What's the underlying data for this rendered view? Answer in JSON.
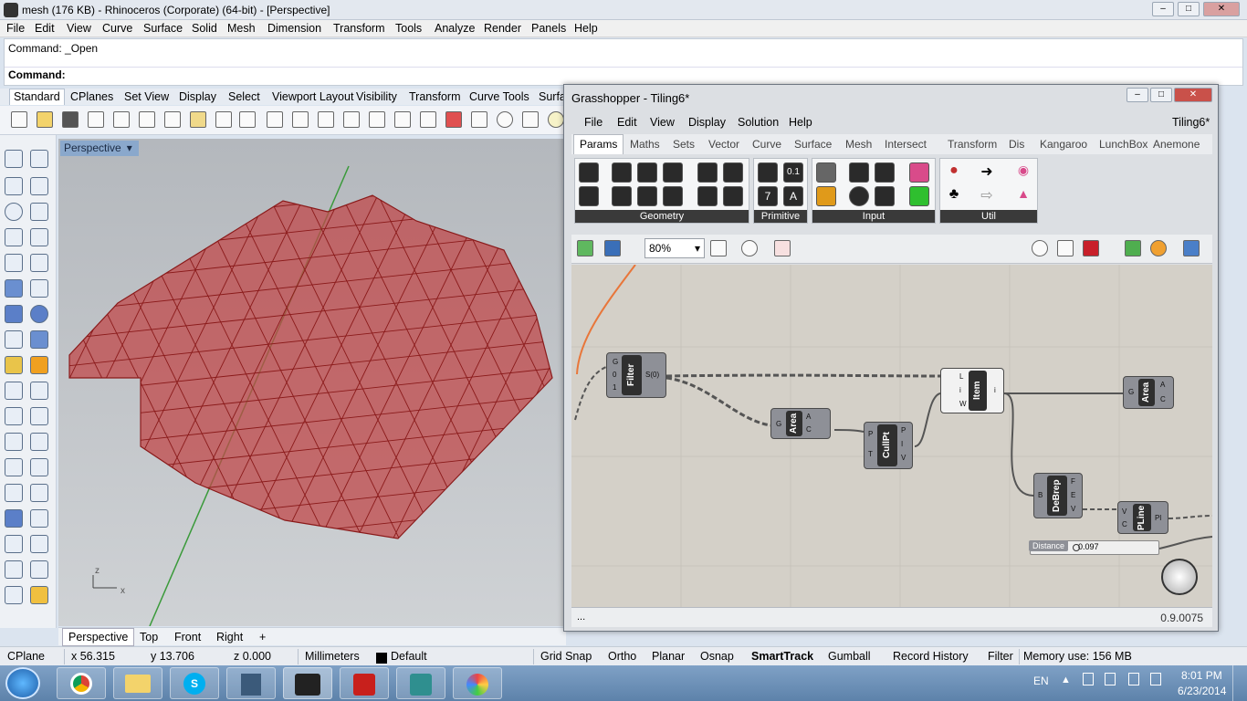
{
  "window": {
    "title": "mesh (176 KB) - Rhinoceros (Corporate) (64-bit) - [Perspective]"
  },
  "menu": [
    "File",
    "Edit",
    "View",
    "Curve",
    "Surface",
    "Solid",
    "Mesh",
    "Dimension",
    "Transform",
    "Tools",
    "Analyze",
    "Render",
    "Panels",
    "Help"
  ],
  "command": {
    "history": "Command: _Open",
    "prompt": "Command:"
  },
  "toolbar_tabs": [
    "Standard",
    "CPlanes",
    "Set View",
    "Display",
    "Select",
    "Viewport Layout",
    "Visibility",
    "Transform",
    "Curve Tools",
    "Surfa"
  ],
  "viewport": {
    "label": "Perspective",
    "axis_z": "z",
    "axis_x": "x",
    "mesh_color": "#c0484a"
  },
  "viewport_tabs": [
    "Perspective",
    "Top",
    "Front",
    "Right",
    "+"
  ],
  "status": {
    "cplane": "CPlane",
    "x": "x 56.315",
    "y": "y 13.706",
    "z": "z 0.000",
    "units": "Millimeters",
    "layer": "Default",
    "toggles": [
      "Grid Snap",
      "Ortho",
      "Planar",
      "Osnap",
      "SmartTrack",
      "Gumball",
      "Record History",
      "Filter"
    ],
    "memory": "Memory use: 156 MB"
  },
  "grasshopper": {
    "title": "Grasshopper - Tiling6*",
    "doc_name": "Tiling6*",
    "menu": [
      "File",
      "Edit",
      "View",
      "Display",
      "Solution",
      "Help"
    ],
    "tabs": [
      "Params",
      "Maths",
      "Sets",
      "Vector",
      "Curve",
      "Surface",
      "Mesh",
      "Intersect",
      "Transform",
      "Dis",
      "Kangaroo",
      "LunchBox",
      "Anemone"
    ],
    "panels": [
      "Geometry",
      "Primitive",
      "Input",
      "Util"
    ],
    "primitive_labels": [
      "0.1",
      "A",
      "7"
    ],
    "zoom": "80%",
    "version": "0.9.0075",
    "footer_left": "...",
    "components": {
      "filter": {
        "name": "Filter",
        "inputs": [
          "G",
          "0",
          "1"
        ],
        "output": "S(0)"
      },
      "area1": {
        "name": "Area",
        "input": "G",
        "outputs": [
          "A",
          "C"
        ]
      },
      "cullpt": {
        "name": "CullPt",
        "inputs": [
          "P",
          "T"
        ],
        "outputs": [
          "P",
          "I",
          "V"
        ]
      },
      "item": {
        "name": "Item",
        "inputs": [
          "L",
          "i",
          "W"
        ],
        "output": "i"
      },
      "area2": {
        "name": "Area",
        "input": "G",
        "outputs": [
          "A",
          "C"
        ]
      },
      "debrep": {
        "name": "DeBrep",
        "input": "B",
        "outputs": [
          "F",
          "E",
          "V"
        ]
      },
      "pline": {
        "name": "PLine",
        "inputs": [
          "V",
          "C"
        ],
        "output": "Pl"
      },
      "slider": {
        "label": "Distance",
        "value": "0.097"
      }
    }
  },
  "taskbar": {
    "lang": "EN",
    "time": "8:01 PM",
    "date": "6/23/2014"
  }
}
